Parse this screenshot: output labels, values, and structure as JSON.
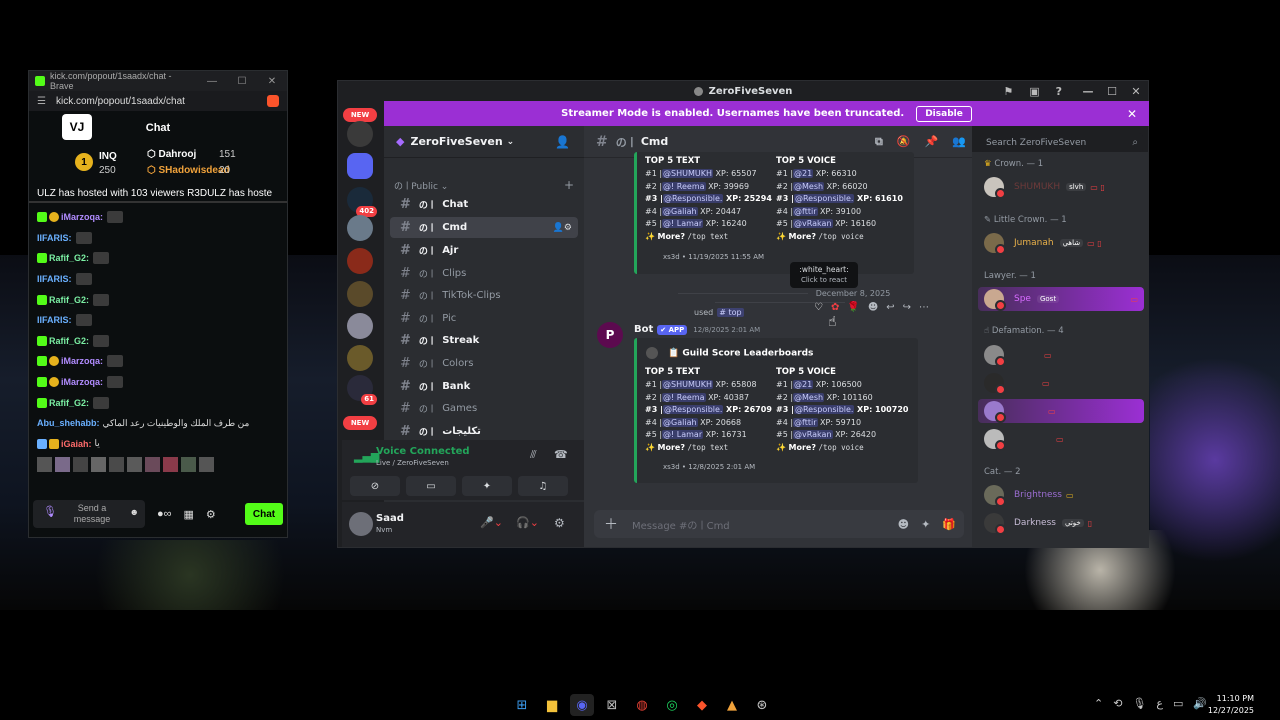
{
  "kick": {
    "window_title": "kick.com/popout/1saadx/chat - Brave",
    "url": "kick.com/popout/1saadx/chat",
    "header_title": "Chat",
    "leaderboard": {
      "rank": "1",
      "top_user": "INQ",
      "top_points": "250",
      "second_user": "Dahrooj",
      "second_points": "151",
      "third_user": "SHadowisdead",
      "third_points": "20"
    },
    "host_banner": "ULZ has hosted with 103 viewers  R3DULZ has hoste",
    "messages": [
      {
        "user": "iMarzoqa:",
        "color": "#b18cff"
      },
      {
        "user": "IIFARIS:",
        "color": "#6ab0ff"
      },
      {
        "user": "Rafif_G2:",
        "color": "#7cf0a4"
      },
      {
        "user": "IIFARIS:",
        "color": "#6ab0ff"
      },
      {
        "user": "Rafif_G2:",
        "color": "#7cf0a4"
      },
      {
        "user": "IIFARIS:",
        "color": "#6ab0ff"
      },
      {
        "user": "Rafif_G2:",
        "color": "#7cf0a4"
      },
      {
        "user": "iMarzoqa:",
        "color": "#b18cff"
      },
      {
        "user": "iMarzoqa:",
        "color": "#b18cff"
      },
      {
        "user": "Rafif_G2:",
        "color": "#7cf0a4"
      },
      {
        "user": "Abu_shehabb:",
        "color": "#6ab0ff",
        "text": "من طرف الملك والوطينيات رعد الماكي"
      },
      {
        "user": "iGaiah:",
        "color": "#ff6b6b",
        "text": "يا"
      }
    ],
    "send_placeholder": "Send a message",
    "chat_button": "Chat",
    "accent": "#53fc18"
  },
  "discord": {
    "window_title": "ZeroFiveSeven",
    "banner": "Streamer Mode is enabled. Usernames have been truncated.",
    "banner_button": "Disable",
    "server_name": "ZeroFiveSeven",
    "rail": {
      "new_top": "NEW",
      "badge_402": "402",
      "badge_61": "61",
      "new_bottom": "NEW"
    },
    "category": "Public",
    "channels": [
      {
        "name": "Chat",
        "state": "unread"
      },
      {
        "name": "Cmd",
        "state": "active"
      },
      {
        "name": "Ajr",
        "state": "unread"
      },
      {
        "name": "Clips",
        "state": ""
      },
      {
        "name": "TikTok-Clips",
        "state": ""
      },
      {
        "name": "Pic",
        "state": ""
      },
      {
        "name": "Streak",
        "state": "unread"
      },
      {
        "name": "Colors",
        "state": ""
      },
      {
        "name": "Bank",
        "state": "unread"
      },
      {
        "name": "Games",
        "state": ""
      },
      {
        "name": "تكليجات",
        "state": "unread"
      }
    ],
    "voice": {
      "status": "Voice Connected",
      "sub": "Live / ZeroFiveSeven"
    },
    "user": {
      "name": "Saad",
      "status": "Nvm"
    },
    "channel_header": "Cmd",
    "search_placeholder": "Search ZeroFiveSeven",
    "embed1": {
      "text_title": "TOP 5 TEXT",
      "voice_title": "TOP 5 VOICE",
      "text_rows": [
        {
          "rank": "#1 |",
          "name": "@SHUMUKH",
          "xp": "XP: 65507",
          "bold": false
        },
        {
          "rank": "#2 |",
          "name": "@! Reema",
          "xp": "XP: 39969",
          "bold": false
        },
        {
          "rank": "#3 |",
          "name": "@Responsible.",
          "xp": "XP: 25294",
          "bold": true
        },
        {
          "rank": "#4 |",
          "name": "@Galiah",
          "xp": "XP: 20447",
          "bold": false
        },
        {
          "rank": "#5 |",
          "name": "@! Lamar",
          "xp": "XP: 16240",
          "bold": false
        }
      ],
      "voice_rows": [
        {
          "rank": "#1 |",
          "name": "@21",
          "xp": "XP: 66310",
          "bold": false
        },
        {
          "rank": "#2 |",
          "name": "@Mesh",
          "xp": "XP: 66020",
          "bold": false
        },
        {
          "rank": "#3 |",
          "name": "@Responsible.",
          "xp": "XP: 61610",
          "bold": true
        },
        {
          "rank": "#4 |",
          "name": "@fttir",
          "xp": "XP: 39100",
          "bold": false
        },
        {
          "rank": "#5 |",
          "name": "@vRakan",
          "xp": "XP: 16160",
          "bold": false
        }
      ],
      "more_text": "More?",
      "more_cmd_text": "/top text",
      "more_cmd_voice": "/top voice",
      "footer": "xs3d • 11/19/2025 11:55 AM"
    },
    "tooltip": {
      "title": ":white_heart:",
      "sub": "Click to react"
    },
    "date_divider": "December 8, 2025",
    "used_text": "used",
    "used_cmd": "top",
    "bot": {
      "name": "Bot",
      "tag": "APP",
      "timestamp": "12/8/2025 2:01 AM"
    },
    "embed2": {
      "title": "Guild Score Leaderboards",
      "text_title": "TOP 5 TEXT",
      "voice_title": "TOP 5 VOICE",
      "text_rows": [
        {
          "rank": "#1 |",
          "name": "@SHUMUKH",
          "xp": "XP: 65808",
          "bold": false
        },
        {
          "rank": "#2 |",
          "name": "@! Reema",
          "xp": "XP: 40387",
          "bold": false
        },
        {
          "rank": "#3 |",
          "name": "@Responsible.",
          "xp": "XP: 26709",
          "bold": true
        },
        {
          "rank": "#4 |",
          "name": "@Galiah",
          "xp": "XP: 20668",
          "bold": false
        },
        {
          "rank": "#5 |",
          "name": "@! Lamar",
          "xp": "XP: 16731",
          "bold": false
        }
      ],
      "voice_rows": [
        {
          "rank": "#1 |",
          "name": "@21",
          "xp": "XP: 106500",
          "bold": false
        },
        {
          "rank": "#2 |",
          "name": "@Mesh",
          "xp": "XP: 101160",
          "bold": false
        },
        {
          "rank": "#3 |",
          "name": "@Responsible.",
          "xp": "XP: 100720",
          "bold": true
        },
        {
          "rank": "#4 |",
          "name": "@fttir",
          "xp": "XP: 59710",
          "bold": false
        },
        {
          "rank": "#5 |",
          "name": "@vRakan",
          "xp": "XP: 26420",
          "bold": false
        }
      ],
      "more_text": "More?",
      "more_cmd_text": "/top text",
      "more_cmd_voice": "/top voice",
      "footer": "xs3d • 12/8/2025 2:01 AM"
    },
    "composer_placeholder": "Message #のㅣCmd",
    "members": {
      "cat1": "Crown. — 1",
      "m1": {
        "name": "SHUMUKH",
        "tag": "slvh",
        "color": "#6d3a3a"
      },
      "cat2": "Little Crown. — 1",
      "m2": {
        "name": "Jumanah",
        "tag": "شاهي",
        "color": "#e8b04a"
      },
      "cat3": "Lawyer. — 1",
      "m3": {
        "name": "Spe",
        "tag": "Gost",
        "color": "#d76cff"
      },
      "cat4": "Defamation. — 4",
      "cat5": "Cat. — 2",
      "m8": {
        "name": "Brightness",
        "color": "#9b6dd1"
      },
      "m9": {
        "name": "Darkness",
        "tag": "خوتي",
        "color": "#c7bcd6"
      }
    },
    "accent": "#9b2fd4"
  },
  "taskbar": {
    "time": "11:10 PM",
    "date": "12/27/2025",
    "lang": "ع"
  }
}
